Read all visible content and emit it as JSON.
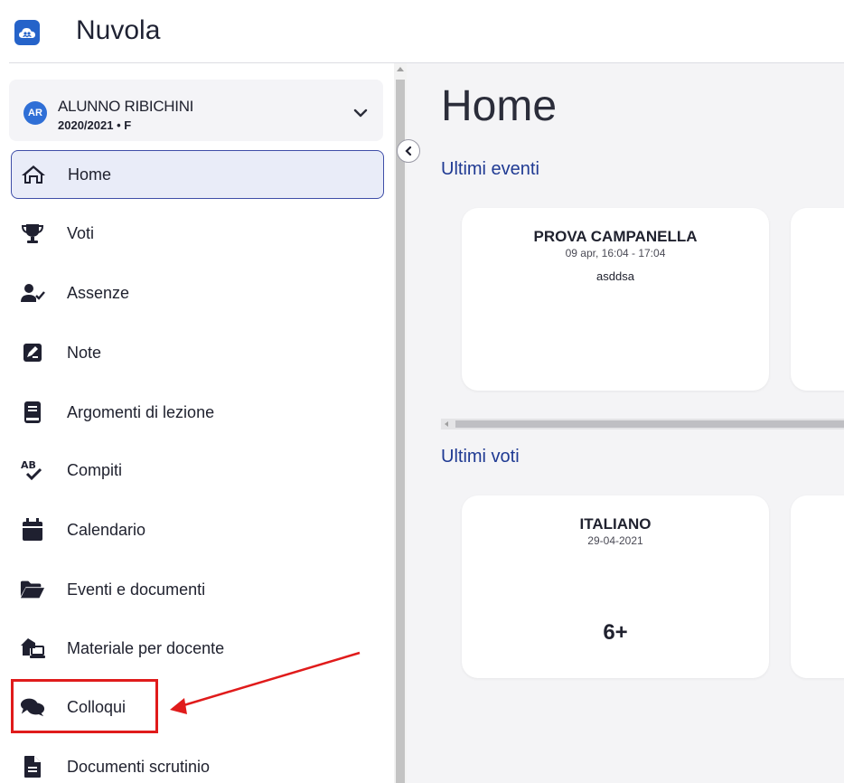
{
  "app": {
    "title": "Nuvola",
    "accent": "#2563c9"
  },
  "user": {
    "initials": "AR",
    "name": "ALUNNO RIBICHINI",
    "sub": "2020/2021 • F"
  },
  "sidebar": {
    "items": [
      {
        "label": "Home",
        "icon": "home-icon",
        "active": true
      },
      {
        "label": "Voti",
        "icon": "trophy-icon"
      },
      {
        "label": "Assenze",
        "icon": "user-check-icon"
      },
      {
        "label": "Note",
        "icon": "note-icon"
      },
      {
        "label": "Argomenti di lezione",
        "icon": "book-icon"
      },
      {
        "label": "Compiti",
        "icon": "spellcheck-icon"
      },
      {
        "label": "Calendario",
        "icon": "calendar-icon"
      },
      {
        "label": "Eventi e documenti",
        "icon": "folder-open-icon"
      },
      {
        "label": "Materiale per docente",
        "icon": "house-laptop-icon"
      },
      {
        "label": "Colloqui",
        "icon": "comments-icon"
      },
      {
        "label": "Documenti scrutinio",
        "icon": "file-icon"
      }
    ]
  },
  "main": {
    "title": "Home",
    "events_section": "Ultimi eventi",
    "events": [
      {
        "title": "PROVA CAMPANELLA",
        "time": "09 apr, 16:04 - 17:04",
        "desc": "asddsa"
      }
    ],
    "grades_section": "Ultimi voti",
    "grades": [
      {
        "subject": "ITALIANO",
        "date": "29-04-2021",
        "grade": "6+"
      }
    ]
  },
  "annotation": {
    "color": "#e01b1b"
  }
}
